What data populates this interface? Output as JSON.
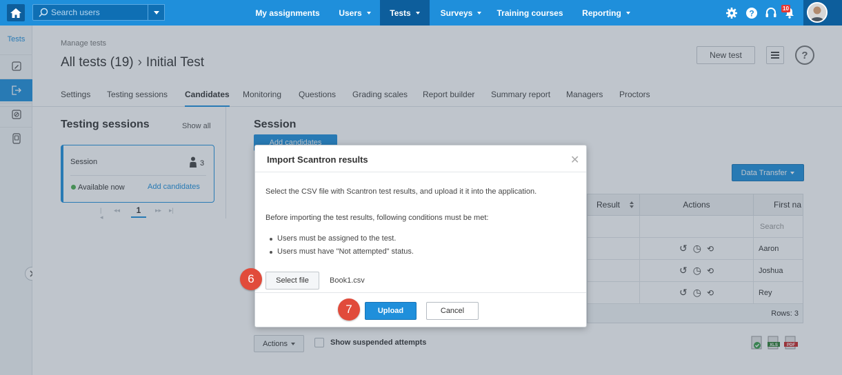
{
  "nav": {
    "search_placeholder": "Search users",
    "items": [
      {
        "label": "My assignments"
      },
      {
        "label": "Users"
      },
      {
        "label": "Tests"
      },
      {
        "label": "Surveys"
      },
      {
        "label": "Training courses"
      },
      {
        "label": "Reporting"
      }
    ],
    "notification_count": "10",
    "accent_color": "#1f8fdb",
    "active_color": "#0d5e9c"
  },
  "rail": {
    "title": "Tests",
    "icons": [
      "edit-icon",
      "exit-icon",
      "no-entry-icon",
      "document-icon"
    ]
  },
  "header": {
    "breadcrumb": "Manage tests",
    "title_parent": "All tests (19)",
    "title_sep": "›",
    "title_current": "Initial Test",
    "new_test_label": "New test"
  },
  "tabs": [
    {
      "label": "Settings"
    },
    {
      "label": "Testing sessions"
    },
    {
      "label": "Candidates"
    },
    {
      "label": "Monitoring"
    },
    {
      "label": "Questions"
    },
    {
      "label": "Grading scales"
    },
    {
      "label": "Report builder"
    },
    {
      "label": "Summary report"
    },
    {
      "label": "Managers"
    },
    {
      "label": "Proctors"
    }
  ],
  "sessions": {
    "heading": "Testing sessions",
    "show_all": "Show all",
    "card": {
      "name": "Session",
      "count": "3",
      "status": "Available now",
      "add_link": "Add candidates"
    },
    "pager": {
      "current": "1"
    }
  },
  "main": {
    "heading": "Session",
    "add_candidates": "Add candidates",
    "data_transfer": "Data Transfer",
    "columns": {
      "result": "Result",
      "actions": "Actions",
      "first_name": "First na"
    },
    "filter_placeholder": "Search",
    "rows": [
      {
        "first_name": "Aaron"
      },
      {
        "first_name": "Joshua"
      },
      {
        "first_name": "Rey"
      }
    ],
    "rows_count": "Rows: 3",
    "actions_btn": "Actions",
    "suspended_label": "Show suspended attempts"
  },
  "modal": {
    "title": "Import Scantron results",
    "text1": "Select the CSV file with Scantron test results, and upload it it into the application.",
    "text2": "Before importing the test results, following conditions must be met:",
    "bullets": [
      "Users must be assigned to the test.",
      "Users must have \"Not attempted\" status."
    ],
    "select_file": "Select file",
    "file_name": "Book1.csv",
    "upload": "Upload",
    "cancel": "Cancel"
  },
  "steps": {
    "a": "6",
    "b": "7",
    "color": "#e14b3b"
  }
}
